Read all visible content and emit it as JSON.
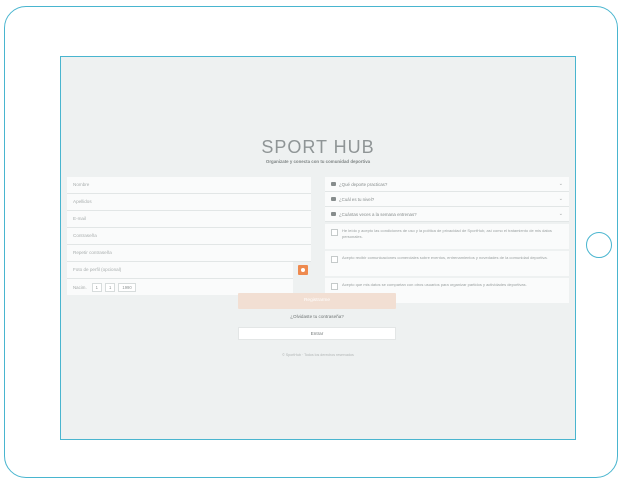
{
  "app": {
    "logo": "SPORT HUB",
    "tagline": "Organizate y conecta con tu comunidad deportiva"
  },
  "form": {
    "fields": [
      {
        "placeholder": "Nombre"
      },
      {
        "placeholder": "Apellidos"
      },
      {
        "placeholder": "E-mail"
      },
      {
        "placeholder": "Contraseña"
      },
      {
        "placeholder": "Repetir contraseña"
      }
    ],
    "photo_placeholder": "Foto de perfil (opcional)",
    "dob": {
      "label": "Nacim.",
      "day": "1",
      "month": "1",
      "year": "1990"
    }
  },
  "preferences": {
    "selects": [
      {
        "label": "¿Qué deporte practicas?"
      },
      {
        "label": "¿Cuál es tu nivel?"
      },
      {
        "label": "¿Cuántas veces a la semana entrenas?"
      }
    ],
    "checks": [
      {
        "text": "He leído y acepto las condiciones de uso y la política de privacidad de SportHub, así como el tratamiento de mis datos personales."
      },
      {
        "text": "Acepto recibir comunicaciones comerciales sobre eventos, entrenamientos y novedades de la comunidad deportiva."
      },
      {
        "text": "Acepto que mis datos se compartan con otros usuarios para organizar partidos y actividades deportivas."
      }
    ]
  },
  "actions": {
    "submit_label": "Registrarme",
    "forgot_label": "¿Olvidaste tu contraseña?",
    "login_label": "Entrar"
  },
  "footer": {
    "text": "© SportHub · Todos los derechos reservados"
  },
  "colors": {
    "frame": "#49b5cf",
    "accent": "#ee8a4f",
    "background": "#eef1f1"
  }
}
